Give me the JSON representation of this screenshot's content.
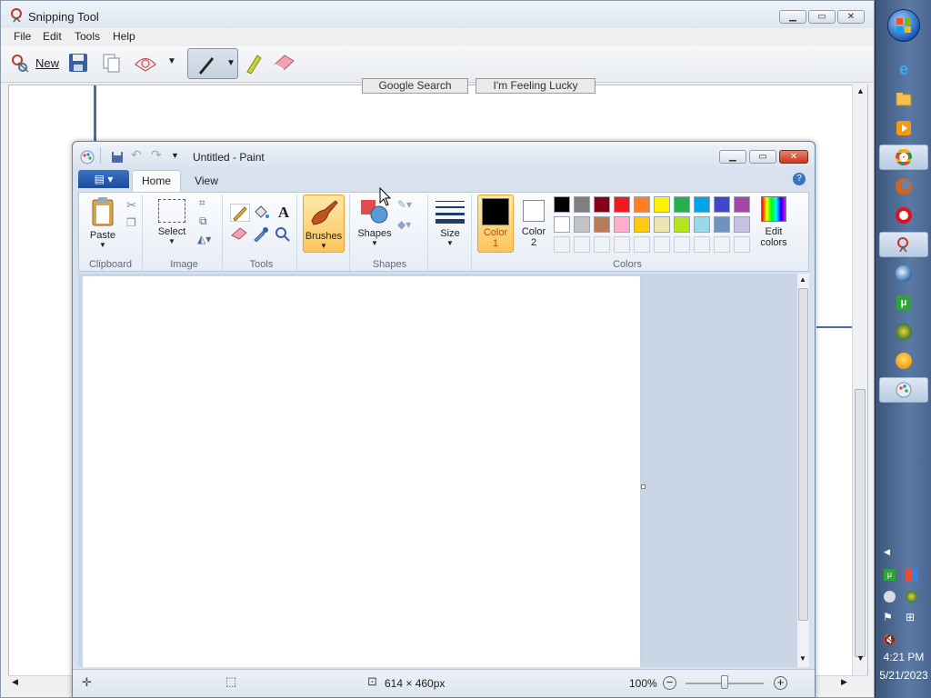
{
  "snipping": {
    "title": "Snipping Tool",
    "menu": [
      "File",
      "Edit",
      "Tools",
      "Help"
    ],
    "new_label": "New",
    "bg_buttons": [
      "Google Search",
      "I'm Feeling Lucky"
    ]
  },
  "paint": {
    "title": "Untitled - Paint",
    "tabs": [
      "Home",
      "View"
    ],
    "groups": {
      "clipboard": "Clipboard",
      "image": "Image",
      "tools": "Tools",
      "shapes": "Shapes",
      "colors": "Colors"
    },
    "buttons": {
      "paste": "Paste",
      "select": "Select",
      "brushes": "Brushes",
      "shapes": "Shapes",
      "size": "Size",
      "color1_a": "Color",
      "color1_b": "1",
      "color2_a": "Color",
      "color2_b": "2",
      "edit_colors_a": "Edit",
      "edit_colors_b": "colors"
    },
    "palette_row1": [
      "#000000",
      "#7f7f7f",
      "#880015",
      "#ed1c24",
      "#ff7f27",
      "#fff200",
      "#22b14c",
      "#00a2e8",
      "#3f48cc",
      "#a349a4"
    ],
    "palette_row2": [
      "#ffffff",
      "#c3c3c3",
      "#b97a57",
      "#ffaec9",
      "#ffc90e",
      "#efe4b0",
      "#b5e61d",
      "#99d9ea",
      "#7092be",
      "#c8bfe7"
    ],
    "status": {
      "dimensions": "614 × 460px",
      "zoom": "100%"
    }
  },
  "taskbar": {
    "time": "4:21 PM",
    "date": "5/21/2023"
  }
}
